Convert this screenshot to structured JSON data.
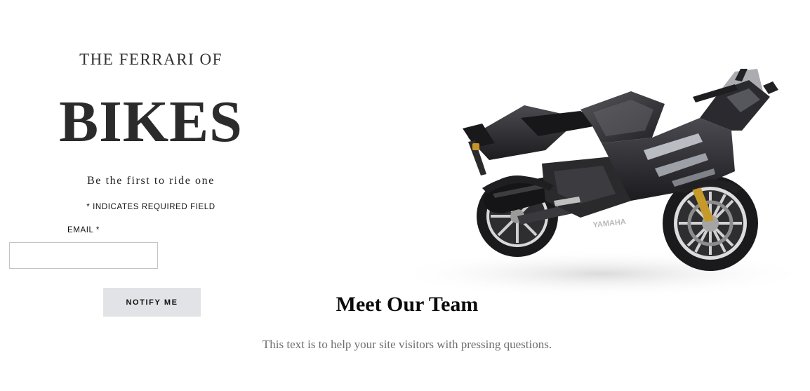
{
  "hero": {
    "eyebrow": "THE FERRARI OF",
    "headline": "BIKES",
    "tagline": "Be the first to ride one"
  },
  "signup_form": {
    "required_note": "* INDICATES REQUIRED FIELD",
    "email_label": "EMAIL *",
    "email_value": "",
    "email_placeholder": "",
    "submit_label": "NOTIFY ME"
  },
  "bike_image": {
    "icon": "motorcycle-image",
    "brand_text": "YAMAHA"
  },
  "team_section": {
    "heading": "Meet Our Team",
    "description": "This text is to help your site visitors with pressing questions."
  },
  "colors": {
    "headline": "#2b2b2b",
    "button_bg": "#e1e3e6",
    "muted_text": "#6e6e6e",
    "bike_body": "#2a2a2d"
  }
}
